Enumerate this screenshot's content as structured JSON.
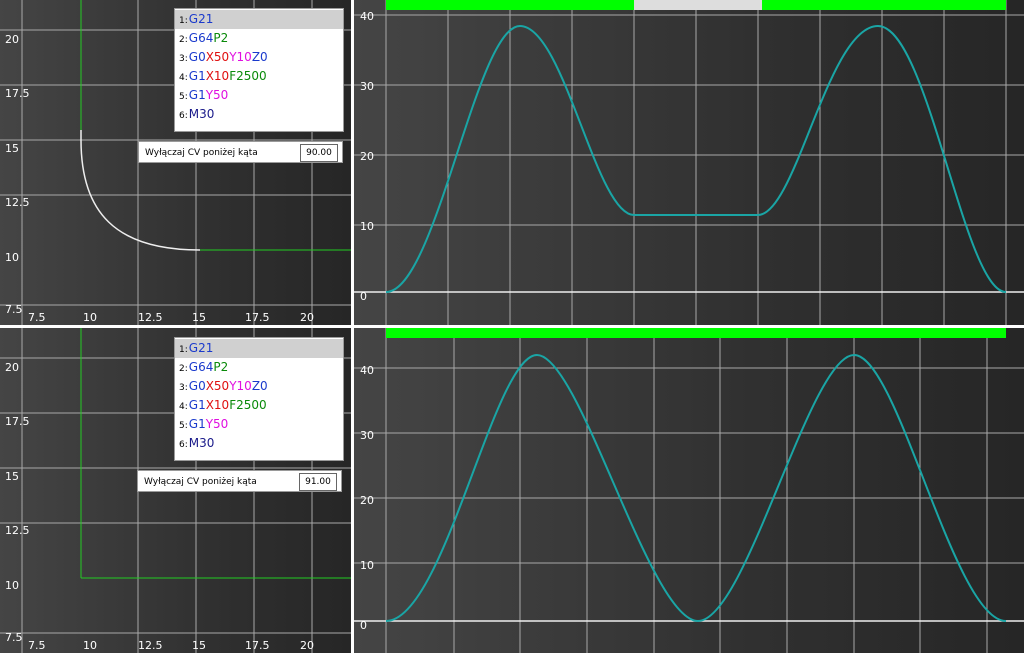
{
  "colors": {
    "grid": "#a8a8a8",
    "path_green": "#22cc22",
    "path_white": "#eeeeee",
    "curve": "#1aa5a5",
    "bar_green": "#00ff00",
    "bar_gray": "#dddddd",
    "g_blue": "#1a3acc",
    "g_green": "#0a8a0a",
    "g_red": "#e01010",
    "g_magenta": "#e010e0",
    "g_navy": "#1a1a8a"
  },
  "top": {
    "path_ticks": {
      "y": [
        "20",
        "17.5",
        "15",
        "12.5",
        "10",
        "7.5"
      ],
      "x": [
        "7.5",
        "10",
        "12.5",
        "15",
        "17.5",
        "20"
      ]
    },
    "gcode": [
      {
        "num": "1:",
        "selected": true,
        "parts": [
          {
            "t": "G21",
            "c": "g_blue"
          }
        ]
      },
      {
        "num": "2:",
        "selected": false,
        "parts": [
          {
            "t": "G64",
            "c": "g_blue"
          },
          {
            "t": "P2",
            "c": "g_green"
          }
        ]
      },
      {
        "num": "3:",
        "selected": false,
        "parts": [
          {
            "t": "G0",
            "c": "g_blue"
          },
          {
            "t": "X50",
            "c": "g_red"
          },
          {
            "t": "Y10",
            "c": "g_magenta"
          },
          {
            "t": "Z0",
            "c": "g_blue"
          }
        ]
      },
      {
        "num": "4:",
        "selected": false,
        "parts": [
          {
            "t": "G1",
            "c": "g_blue"
          },
          {
            "t": "X10",
            "c": "g_red"
          },
          {
            "t": "F2500",
            "c": "g_green"
          }
        ]
      },
      {
        "num": "5:",
        "selected": false,
        "parts": [
          {
            "t": "G1",
            "c": "g_blue"
          },
          {
            "t": "Y50",
            "c": "g_magenta"
          }
        ]
      },
      {
        "num": "6:",
        "selected": false,
        "parts": [
          {
            "t": "M30",
            "c": "g_navy"
          }
        ]
      }
    ],
    "cv_label": "Wyłączaj CV poniżej kąta",
    "cv_value": "90.00",
    "velocity_ticks": [
      "40",
      "30",
      "20",
      "10",
      "0"
    ]
  },
  "bottom": {
    "path_ticks": {
      "y": [
        "20",
        "17.5",
        "15",
        "12.5",
        "10",
        "7.5"
      ],
      "x": [
        "7.5",
        "10",
        "12.5",
        "15",
        "17.5",
        "20"
      ]
    },
    "gcode": [
      {
        "num": "1:",
        "selected": true,
        "parts": [
          {
            "t": "G21",
            "c": "g_blue"
          }
        ]
      },
      {
        "num": "2:",
        "selected": false,
        "parts": [
          {
            "t": "G64",
            "c": "g_blue"
          },
          {
            "t": "P2",
            "c": "g_green"
          }
        ]
      },
      {
        "num": "3:",
        "selected": false,
        "parts": [
          {
            "t": "G0",
            "c": "g_blue"
          },
          {
            "t": "X50",
            "c": "g_red"
          },
          {
            "t": "Y10",
            "c": "g_magenta"
          },
          {
            "t": "Z0",
            "c": "g_blue"
          }
        ]
      },
      {
        "num": "4:",
        "selected": false,
        "parts": [
          {
            "t": "G1",
            "c": "g_blue"
          },
          {
            "t": "X10",
            "c": "g_red"
          },
          {
            "t": "F2500",
            "c": "g_green"
          }
        ]
      },
      {
        "num": "5:",
        "selected": false,
        "parts": [
          {
            "t": "G1",
            "c": "g_blue"
          },
          {
            "t": "Y50",
            "c": "g_magenta"
          }
        ]
      },
      {
        "num": "6:",
        "selected": false,
        "parts": [
          {
            "t": "M30",
            "c": "g_navy"
          }
        ]
      }
    ],
    "cv_label": "Wyłączaj CV poniżej kąta",
    "cv_value": "91.00",
    "velocity_ticks": [
      "40",
      "30",
      "20",
      "10",
      "0"
    ]
  }
}
